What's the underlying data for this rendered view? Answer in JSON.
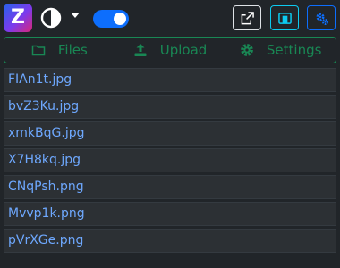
{
  "app": {
    "logo_letter": "Z"
  },
  "tabs": [
    {
      "label": "Files",
      "icon": "folder-icon"
    },
    {
      "label": "Upload",
      "icon": "upload-icon"
    },
    {
      "label": "Settings",
      "icon": "gear-icon"
    }
  ],
  "files": [
    "FIAn1t.jpg",
    "bvZ3Ku.jpg",
    "xmkBqG.jpg",
    "X7H8kq.jpg",
    "CNqPsh.png",
    "Mvvp1k.png",
    "pVrXGe.png"
  ],
  "toggles": {
    "dark_mode_switch_on": true
  },
  "colors": {
    "background": "#212529",
    "accent": "#0d6efd",
    "success": "#198754",
    "info": "#0dcaf0",
    "link": "#6ea8fe"
  }
}
